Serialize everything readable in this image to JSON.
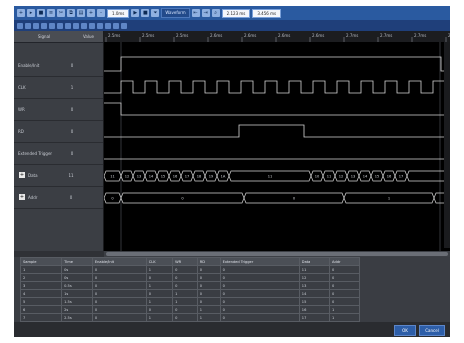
{
  "toolbar": {
    "view_label": "Waveform",
    "zoom_field": "1.0ms",
    "time_a": "2.123 ms",
    "time_b": "3.456 ms"
  },
  "signals_header": {
    "name": "Signal",
    "value": "Value"
  },
  "signals": [
    {
      "name": "Enable/Init",
      "value": "0",
      "expandable": false
    },
    {
      "name": "CLK",
      "value": "1",
      "expandable": false
    },
    {
      "name": "WR",
      "value": "0",
      "expandable": false
    },
    {
      "name": "RD",
      "value": "0",
      "expandable": false
    },
    {
      "name": "Extended Trigger",
      "value": "0",
      "expandable": false
    },
    {
      "name": "Data",
      "value": "11",
      "expandable": true
    },
    {
      "name": "Addr",
      "value": "0",
      "expandable": true
    }
  ],
  "time_ruler": [
    "2.5ms",
    "2.5ms",
    "2.5ms",
    "2.6ms",
    "2.6ms",
    "2.6ms",
    "2.6ms",
    "2.7ms",
    "2.7ms",
    "2.7ms",
    "2.8ms"
  ],
  "data_bus_labels": [
    "11",
    "12",
    "13",
    "14",
    "15",
    "16",
    "17",
    "18",
    "19",
    "1A",
    "11",
    "10",
    "11",
    "12",
    "13",
    "14",
    "15",
    "16",
    "17"
  ],
  "addr_bus_labels": [
    "0",
    "0",
    "0",
    "1"
  ],
  "table": {
    "headers": [
      "Sample",
      "Time",
      "Enable/Init",
      "CLK",
      "WR",
      "RD",
      "Extended Trigger",
      "Data",
      "Addr"
    ],
    "rows": [
      [
        "1",
        "0s",
        "0",
        "1",
        "0",
        "0",
        "0",
        "11",
        "0"
      ],
      [
        "2",
        "0s",
        "0",
        "0",
        "0",
        "0",
        "0",
        "12",
        "0"
      ],
      [
        "3",
        "0.5s",
        "0",
        "1",
        "0",
        "0",
        "0",
        "13",
        "0"
      ],
      [
        "4",
        "1s",
        "0",
        "0",
        "1",
        "0",
        "0",
        "14",
        "0"
      ],
      [
        "5",
        "1.5s",
        "0",
        "1",
        "1",
        "0",
        "0",
        "15",
        "0"
      ],
      [
        "6",
        "2s",
        "0",
        "0",
        "0",
        "1",
        "0",
        "16",
        "1"
      ],
      [
        "7",
        "2.5s",
        "0",
        "1",
        "0",
        "1",
        "0",
        "17",
        "1"
      ],
      [
        "8",
        "3s",
        "0",
        "0",
        "0",
        "0",
        "0",
        "18",
        "1"
      ]
    ]
  },
  "status": {
    "ok_label": "OK",
    "cancel_label": "Cancel"
  },
  "colors": {
    "toolbar": "#2a5aa0",
    "background": "#2f3136",
    "wave": "#000000",
    "trace": "#d6d6d6"
  }
}
